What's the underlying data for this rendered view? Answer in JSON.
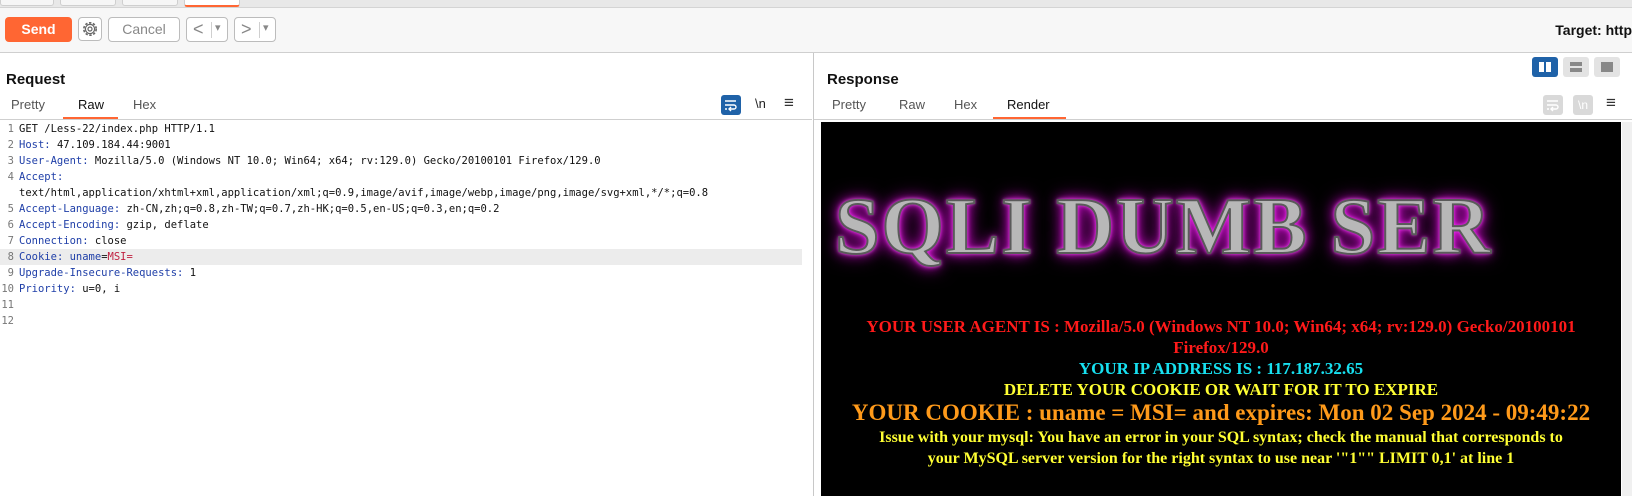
{
  "toolbar": {
    "send_label": "Send",
    "cancel_label": "Cancel",
    "back_glyph": "<",
    "forward_glyph": ">",
    "dropdown_glyph": "▾",
    "target_label": "Target: http"
  },
  "request": {
    "title": "Request",
    "tabs": [
      "Pretty",
      "Raw",
      "Hex"
    ],
    "active_tab": "Raw",
    "newline_toggle": "\\n",
    "menu_glyph": "≡",
    "lines": [
      {
        "num": "1",
        "name": "",
        "sep": "",
        "value": "GET /Less-22/index.php HTTP/1.1"
      },
      {
        "num": "2",
        "name": "Host",
        "sep": ": ",
        "value": "47.109.184.44:9001"
      },
      {
        "num": "3",
        "name": "User-Agent",
        "sep": ": ",
        "value": "Mozilla/5.0 (Windows NT 10.0; Win64; x64; rv:129.0) Gecko/20100101 Firefox/129.0"
      },
      {
        "num": "4",
        "name": "Accept",
        "sep": ":",
        "value": ""
      },
      {
        "num": "",
        "name": "",
        "sep": "",
        "value": "text/html,application/xhtml+xml,application/xml;q=0.9,image/avif,image/webp,image/png,image/svg+xml,*/*;q=0.8"
      },
      {
        "num": "5",
        "name": "Accept-Language",
        "sep": ": ",
        "value": "zh-CN,zh;q=0.8,zh-TW;q=0.7,zh-HK;q=0.5,en-US;q=0.3,en;q=0.2"
      },
      {
        "num": "6",
        "name": "Accept-Encoding",
        "sep": ": ",
        "value": "gzip, deflate"
      },
      {
        "num": "7",
        "name": "Connection",
        "sep": ": ",
        "value": "close"
      },
      {
        "num": "8",
        "name": "Cookie",
        "sep": ": ",
        "cookie_name": "uname",
        "cookie_eq": "=",
        "cookie_value": "MSI="
      },
      {
        "num": "9",
        "name": "Upgrade-Insecure-Requests",
        "sep": ": ",
        "value": "1"
      },
      {
        "num": "10",
        "name": "Priority",
        "sep": ": ",
        "value": "u=0, i"
      },
      {
        "num": "11",
        "name": "",
        "sep": "",
        "value": ""
      },
      {
        "num": "12",
        "name": "",
        "sep": "",
        "value": ""
      }
    ]
  },
  "response": {
    "title": "Response",
    "tabs": [
      "Pretty",
      "Raw",
      "Hex",
      "Render"
    ],
    "active_tab": "Render",
    "newline_toggle": "\\n",
    "menu_glyph": "≡",
    "render": {
      "banner": "SQLI DUMB SER",
      "user_agent_line1": "YOUR USER AGENT IS : Mozilla/5.0 (Windows NT 10.0; Win64; x64; rv:129.0) Gecko/20100101",
      "user_agent_line2": "Firefox/129.0",
      "ip_line": "YOUR IP ADDRESS IS : 117.187.32.65",
      "delete_line": "DELETE YOUR COOKIE OR WAIT FOR IT TO EXPIRE",
      "cookie_line": "YOUR COOKIE : uname = MSI= and expires: Mon 02 Sep 2024 - 09:49:22",
      "error_line1": "Issue with your mysql: You have an error in your SQL syntax; check the manual that corresponds to",
      "error_line2": "your MySQL server version for the right syntax to use near '\"1\"\" LIMIT 0,1' at line 1"
    }
  },
  "colors": {
    "accent": "#ff6633",
    "header_name": "#1f3fa8",
    "cookie_value": "#c02040",
    "icon_blue": "#1f62a8"
  }
}
